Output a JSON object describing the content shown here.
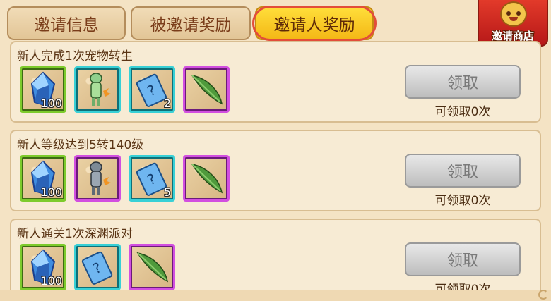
{
  "tabs": [
    {
      "label": "邀请信息",
      "active": false
    },
    {
      "label": "被邀请奖励",
      "active": false
    },
    {
      "label": "邀请人奖励",
      "active": true
    }
  ],
  "shop": {
    "label": "邀请商店"
  },
  "tasks": [
    {
      "title": "新人完成1次宠物转生",
      "rewards": [
        {
          "icon": "blue-crystal-icon",
          "rarity": "green",
          "quantity": "100"
        },
        {
          "icon": "pet-figure-icon",
          "rarity": "teal",
          "quantity": ""
        },
        {
          "icon": "mystery-card-icon",
          "rarity": "teal",
          "quantity": "2"
        },
        {
          "icon": "green-feather-icon",
          "rarity": "purple",
          "quantity": ""
        }
      ],
      "button": "领取",
      "remaining": "可领取0次"
    },
    {
      "title": "新人等级达到5转140级",
      "rewards": [
        {
          "icon": "blue-crystal-icon",
          "rarity": "green",
          "quantity": "100"
        },
        {
          "icon": "pet-figure-icon",
          "rarity": "purple",
          "quantity": ""
        },
        {
          "icon": "mystery-card-icon",
          "rarity": "teal",
          "quantity": "5"
        },
        {
          "icon": "green-feather-icon",
          "rarity": "purple",
          "quantity": ""
        }
      ],
      "button": "领取",
      "remaining": "可领取0次"
    },
    {
      "title": "新人通关1次深渊派对",
      "rewards": [
        {
          "icon": "blue-crystal-icon",
          "rarity": "green",
          "quantity": "100"
        },
        {
          "icon": "mystery-card-icon",
          "rarity": "teal",
          "quantity": ""
        },
        {
          "icon": "green-feather-icon",
          "rarity": "purple",
          "quantity": ""
        }
      ],
      "button": "领取",
      "remaining": "可领取0次"
    }
  ]
}
